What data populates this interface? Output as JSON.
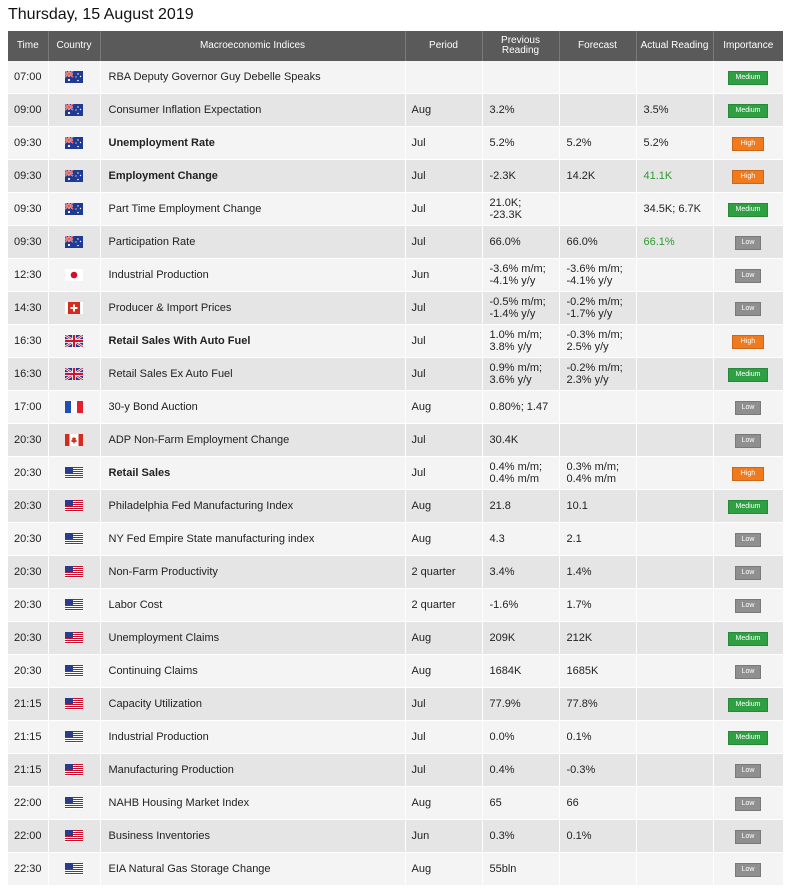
{
  "page": {
    "date_title": "Thursday, 15 August 2019"
  },
  "header": {
    "time": "Time",
    "country": "Country",
    "indices": "Macroeconomic Indices",
    "period": "Period",
    "previous": "Previous Reading",
    "forecast": "Forecast",
    "actual": "Actual Reading",
    "importance": "Importance"
  },
  "rows": [
    {
      "time": "07:00",
      "flag": "au-flag-icon",
      "event": "RBA Deputy Governor Guy Debelle Speaks",
      "bold": false,
      "period": "",
      "prev": "",
      "fcst": "",
      "act": "",
      "act_green": false,
      "imp": "Medium",
      "imp_level": "medium"
    },
    {
      "time": "09:00",
      "flag": "au-flag-icon",
      "event": "Consumer Inflation Expectation",
      "bold": false,
      "period": "Aug",
      "prev": "3.2%",
      "fcst": "",
      "act": "3.5%",
      "act_green": false,
      "imp": "Medium",
      "imp_level": "medium"
    },
    {
      "time": "09:30",
      "flag": "au-flag-icon",
      "event": "Unemployment Rate",
      "bold": true,
      "period": "Jul",
      "prev": "5.2%",
      "fcst": "5.2%",
      "act": "5.2%",
      "act_green": false,
      "imp": "High",
      "imp_level": "high"
    },
    {
      "time": "09:30",
      "flag": "au-flag-icon",
      "event": "Employment Change",
      "bold": true,
      "period": "Jul",
      "prev": "-2.3K",
      "fcst": "14.2K",
      "act": "41.1K",
      "act_green": true,
      "imp": "High",
      "imp_level": "high"
    },
    {
      "time": "09:30",
      "flag": "au-flag-icon",
      "event": "Part Time Employment Change",
      "bold": false,
      "period": "Jul",
      "prev": "21.0K;\n-23.3K",
      "fcst": "",
      "act": "34.5K; 6.7K",
      "act_green": false,
      "imp": "Medium",
      "imp_level": "medium"
    },
    {
      "time": "09:30",
      "flag": "au-flag-icon",
      "event": "Participation Rate",
      "bold": false,
      "period": "Jul",
      "prev": "66.0%",
      "fcst": "66.0%",
      "act": "66.1%",
      "act_green": true,
      "imp": "Low",
      "imp_level": "low"
    },
    {
      "time": "12:30",
      "flag": "jp-flag-icon",
      "event": "Industrial Production",
      "bold": false,
      "period": "Jun",
      "prev": "-3.6% m/m;\n-4.1% y/y",
      "fcst": "-3.6% m/m;\n-4.1% y/y",
      "act": "",
      "act_green": false,
      "imp": "Low",
      "imp_level": "low"
    },
    {
      "time": "14:30",
      "flag": "ch-flag-icon",
      "event": "Producer & Import Prices",
      "bold": false,
      "period": "Jul",
      "prev": "-0.5% m/m;\n-1.4% y/y",
      "fcst": "-0.2% m/m;\n-1.7% y/y",
      "act": "",
      "act_green": false,
      "imp": "Low",
      "imp_level": "low"
    },
    {
      "time": "16:30",
      "flag": "uk-flag-icon",
      "event": "Retail Sales With Auto Fuel",
      "bold": true,
      "period": "Jul",
      "prev": "1.0% m/m;\n3.8% y/y",
      "fcst": "-0.3% m/m;\n2.5% y/y",
      "act": "",
      "act_green": false,
      "imp": "High",
      "imp_level": "high"
    },
    {
      "time": "16:30",
      "flag": "uk-flag-icon",
      "event": "Retail Sales Ex Auto Fuel",
      "bold": false,
      "period": "Jul",
      "prev": "0.9% m/m;\n3.6% y/y",
      "fcst": "-0.2% m/m;\n2.3% y/y",
      "act": "",
      "act_green": false,
      "imp": "Medium",
      "imp_level": "medium"
    },
    {
      "time": "17:00",
      "flag": "fr-flag-icon",
      "event": "30-y Bond Auction",
      "bold": false,
      "period": "Aug",
      "prev": "0.80%; 1.47",
      "fcst": "",
      "act": "",
      "act_green": false,
      "imp": "Low",
      "imp_level": "low"
    },
    {
      "time": "20:30",
      "flag": "ca-flag-icon",
      "event": "ADP Non-Farm Employment Change",
      "bold": false,
      "period": "Jul",
      "prev": "30.4K",
      "fcst": "",
      "act": "",
      "act_green": false,
      "imp": "Low",
      "imp_level": "low"
    },
    {
      "time": "20:30",
      "flag": "us-flag-icon",
      "event": "Retail Sales",
      "bold": true,
      "period": "Jul",
      "prev": "0.4% m/m;\n0.4% m/m",
      "fcst": "0.3% m/m;\n0.4% m/m",
      "act": "",
      "act_green": false,
      "imp": "High",
      "imp_level": "high"
    },
    {
      "time": "20:30",
      "flag": "us-flag-icon",
      "event": "Philadelphia Fed Manufacturing Index",
      "bold": false,
      "period": "Aug",
      "prev": "21.8",
      "fcst": "10.1",
      "act": "",
      "act_green": false,
      "imp": "Medium",
      "imp_level": "medium"
    },
    {
      "time": "20:30",
      "flag": "us-flag-icon",
      "event": "NY Fed Empire State manufacturing index",
      "bold": false,
      "period": "Aug",
      "prev": "4.3",
      "fcst": "2.1",
      "act": "",
      "act_green": false,
      "imp": "Low",
      "imp_level": "low"
    },
    {
      "time": "20:30",
      "flag": "us-flag-icon",
      "event": "Non-Farm Productivity",
      "bold": false,
      "period": "2 quarter",
      "prev": "3.4%",
      "fcst": "1.4%",
      "act": "",
      "act_green": false,
      "imp": "Low",
      "imp_level": "low"
    },
    {
      "time": "20:30",
      "flag": "us-flag-icon",
      "event": "Labor Cost",
      "bold": false,
      "period": "2 quarter",
      "prev": "-1.6%",
      "fcst": "1.7%",
      "act": "",
      "act_green": false,
      "imp": "Low",
      "imp_level": "low"
    },
    {
      "time": "20:30",
      "flag": "us-flag-icon",
      "event": "Unemployment Claims",
      "bold": false,
      "period": "Aug",
      "prev": "209K",
      "fcst": "212K",
      "act": "",
      "act_green": false,
      "imp": "Medium",
      "imp_level": "medium"
    },
    {
      "time": "20:30",
      "flag": "us-flag-icon",
      "event": "Continuing Claims",
      "bold": false,
      "period": "Aug",
      "prev": "1684K",
      "fcst": "1685K",
      "act": "",
      "act_green": false,
      "imp": "Low",
      "imp_level": "low"
    },
    {
      "time": "21:15",
      "flag": "us-flag-icon",
      "event": "Capacity Utilization",
      "bold": false,
      "period": "Jul",
      "prev": "77.9%",
      "fcst": "77.8%",
      "act": "",
      "act_green": false,
      "imp": "Medium",
      "imp_level": "medium"
    },
    {
      "time": "21:15",
      "flag": "us-flag-icon",
      "event": "Industrial Production",
      "bold": false,
      "period": "Jul",
      "prev": "0.0%",
      "fcst": "0.1%",
      "act": "",
      "act_green": false,
      "imp": "Medium",
      "imp_level": "medium"
    },
    {
      "time": "21:15",
      "flag": "us-flag-icon",
      "event": "Manufacturing Production",
      "bold": false,
      "period": "Jul",
      "prev": "0.4%",
      "fcst": "-0.3%",
      "act": "",
      "act_green": false,
      "imp": "Low",
      "imp_level": "low"
    },
    {
      "time": "22:00",
      "flag": "us-flag-icon",
      "event": "NAHB Housing Market Index",
      "bold": false,
      "period": "Aug",
      "prev": "65",
      "fcst": "66",
      "act": "",
      "act_green": false,
      "imp": "Low",
      "imp_level": "low"
    },
    {
      "time": "22:00",
      "flag": "us-flag-icon",
      "event": "Business Inventories",
      "bold": false,
      "period": "Jun",
      "prev": "0.3%",
      "fcst": "0.1%",
      "act": "",
      "act_green": false,
      "imp": "Low",
      "imp_level": "low"
    },
    {
      "time": "22:30",
      "flag": "us-flag-icon",
      "event": "EIA Natural Gas Storage Change",
      "bold": false,
      "period": "Aug",
      "prev": "55bln",
      "fcst": "",
      "act": "",
      "act_green": false,
      "imp": "Low",
      "imp_level": "low"
    }
  ]
}
